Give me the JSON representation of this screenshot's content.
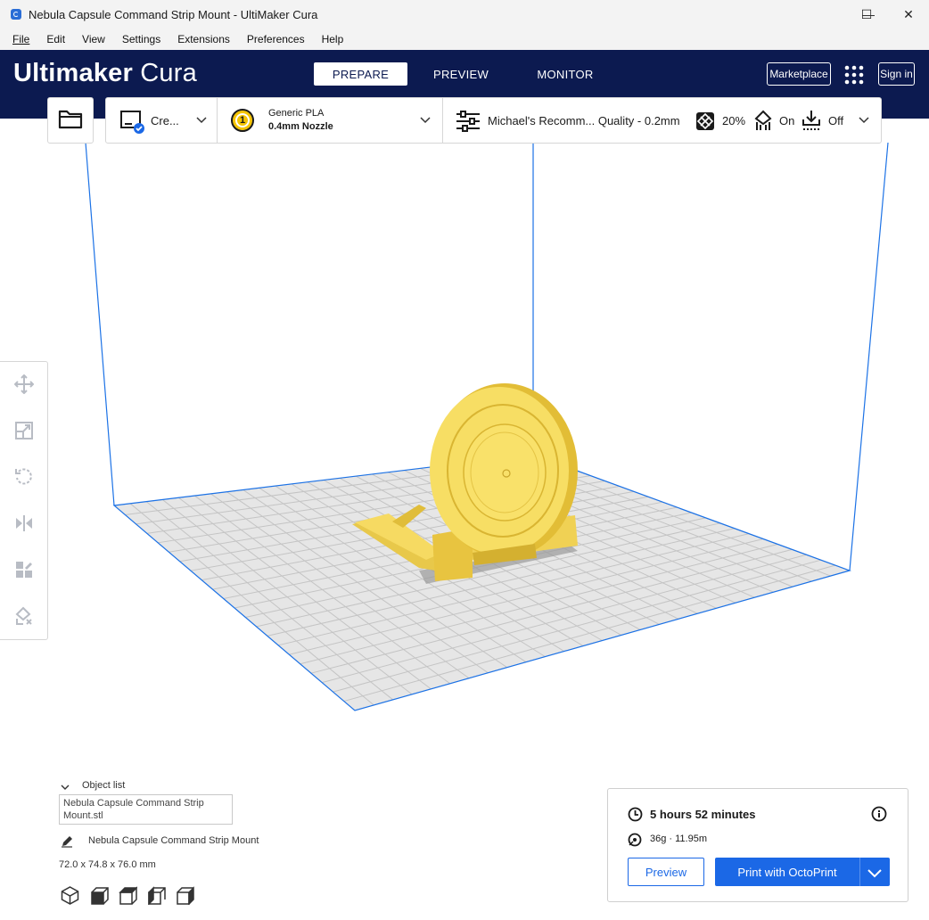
{
  "window": {
    "title": "Nebula Capsule Command Strip Mount - UltiMaker Cura",
    "controls": {
      "minimize": "—",
      "maximize": "☐",
      "close": "✕"
    }
  },
  "menubar": {
    "items": [
      "File",
      "Edit",
      "View",
      "Settings",
      "Extensions",
      "Preferences",
      "Help"
    ]
  },
  "header": {
    "logo_bold": "Ultimaker",
    "logo_light": "Cura",
    "tabs": [
      "PREPARE",
      "PREVIEW",
      "MONITOR"
    ],
    "active_tab": "PREPARE",
    "marketplace_label": "Marketplace",
    "signin_label": "Sign in"
  },
  "toolbar": {
    "printer_label": "Cre...",
    "extruder_number": "1",
    "material": "Generic PLA",
    "nozzle": "0.4mm Nozzle",
    "profile": "Michael's Recomm... Quality - 0.2mm",
    "infill": "20%",
    "support": "On",
    "adhesion": "Off"
  },
  "object_list": {
    "header": "Object list",
    "file_line1": "Nebula Capsule Command Strip",
    "file_line2": "Mount.stl",
    "object_name": "Nebula Capsule Command Strip Mount",
    "dimensions": "72.0 x 74.8 x 76.0 mm"
  },
  "print_panel": {
    "time": "5 hours 52 minutes",
    "material_usage": "36g · 11.95m",
    "preview_label": "Preview",
    "print_label": "Print with OctoPrint"
  },
  "colors": {
    "header_bg": "#0c1a50",
    "accent_blue": "#1b68e6",
    "model_yellow": "#f7dc5c",
    "build_volume_line": "#1c72e6",
    "plate_grid": "#c8c8c8"
  }
}
